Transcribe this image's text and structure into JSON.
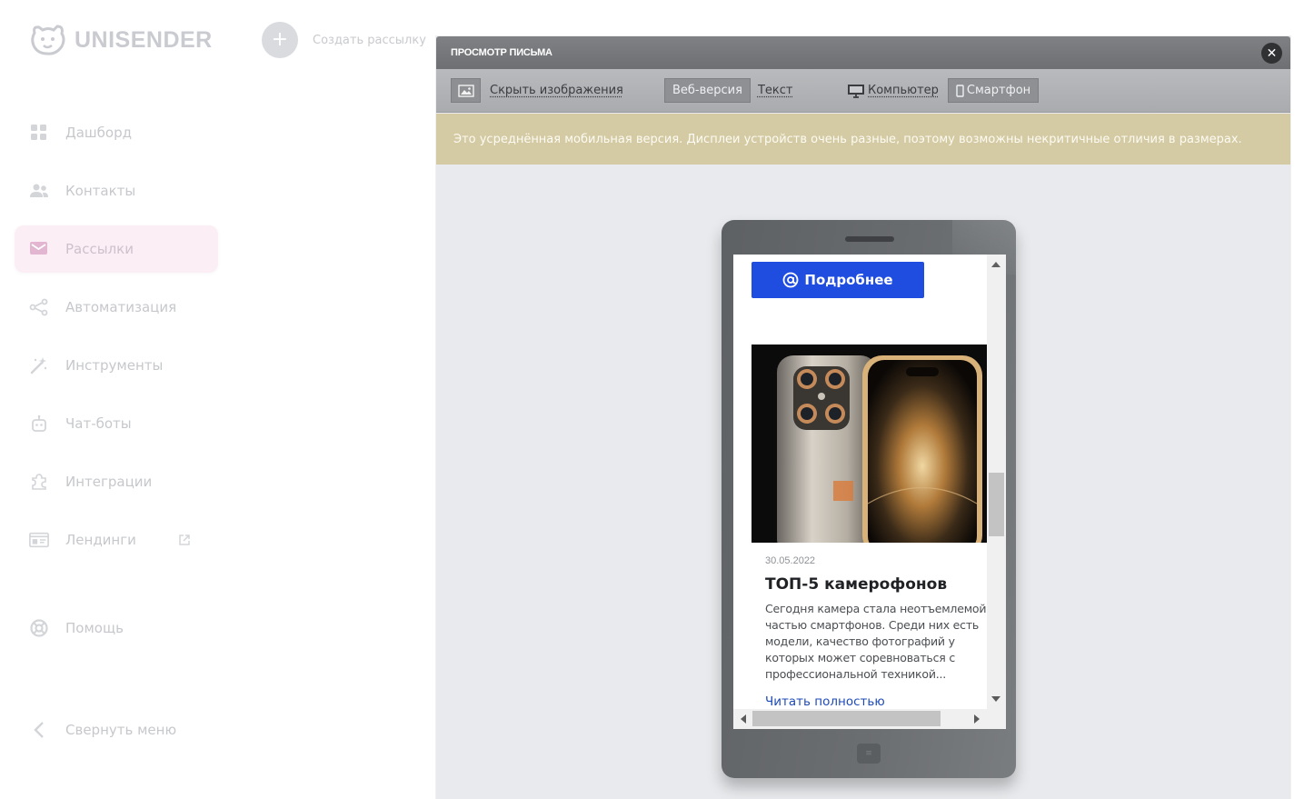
{
  "app": {
    "logo_text": "UNISENDER",
    "create_label": "Создать рассылку",
    "nav": [
      {
        "label": "Дашборд",
        "icon": "dashboard-icon"
      },
      {
        "label": "Контакты",
        "icon": "contacts-icon"
      },
      {
        "label": "Рассылки",
        "icon": "mail-icon",
        "active": true
      },
      {
        "label": "Автоматизация",
        "icon": "automation-icon"
      },
      {
        "label": "Инструменты",
        "icon": "magic-wand-icon"
      },
      {
        "label": "Чат-боты",
        "icon": "robot-icon"
      },
      {
        "label": "Интеграции",
        "icon": "puzzle-icon"
      },
      {
        "label": "Лендинги",
        "icon": "landing-icon",
        "external": true
      },
      {
        "label": "Помощь",
        "icon": "lifebuoy-icon"
      },
      {
        "label": "Свернуть меню",
        "icon": "chevron-left-icon"
      }
    ]
  },
  "modal": {
    "title": "ПРОСМОТР ПИСЬМА",
    "close_symbol": "✕",
    "toolbar": {
      "hide_images": "Скрыть изображения",
      "web_version": "Веб-версия",
      "text_version": "Текст",
      "desktop": "Компьютер",
      "smartphone": "Смартфон"
    },
    "notice": "Это усреднённая мобильная версия. Дисплеи устройств очень разные, поэтому возможны некритичные отличия в размерах."
  },
  "email": {
    "cta_label": "Подробнее",
    "article": {
      "date": "30.05.2022",
      "title": "ТОП-5 камерофонов",
      "text": "Сегодня камера стала неотъемлемой частью смартфонов. Среди них есть модели, качество фотографий у которых может соревноваться с профессиональной техникой...",
      "read_more": "Читать полностью"
    }
  },
  "colors": {
    "accent_blue": "#1f4de0",
    "notice_bg": "#d4caa3",
    "active_nav_bg": "#fbeef5"
  }
}
